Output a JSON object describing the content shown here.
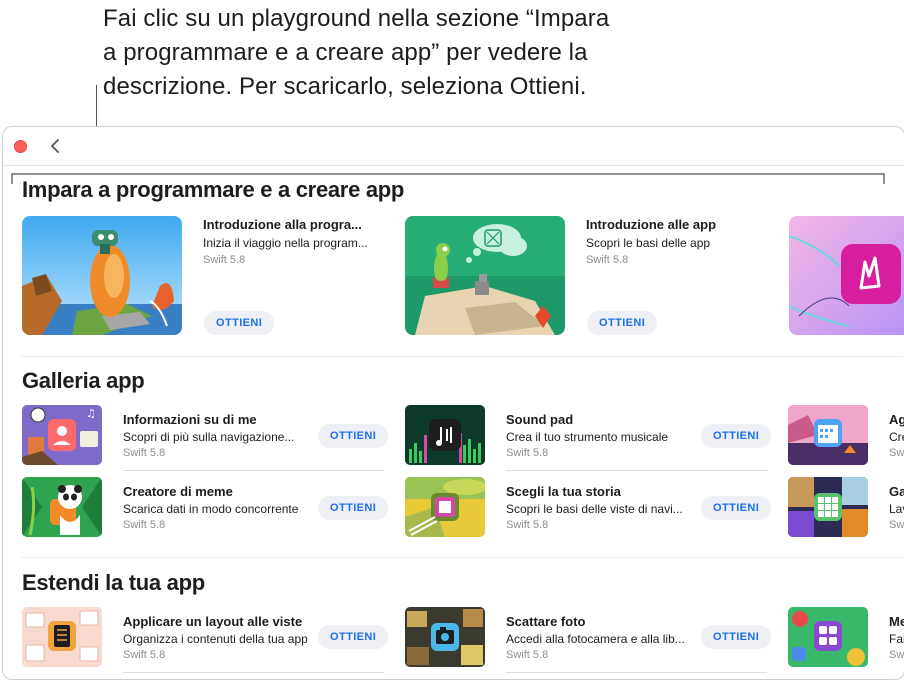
{
  "callout": {
    "line1": "Fai clic su un playground nella sezione “Impara",
    "line2": "a programmare e a creare app” per vedere la",
    "line3": "descrizione. Per scaricarlo, seleziona Ottieni."
  },
  "sections": [
    {
      "title": "Impara a programmare e a creare app",
      "items": [
        {
          "title": "Introduzione alla progra...",
          "desc": "Inizia il viaggio nella program...",
          "version": "Swift 5.8",
          "button": "OTTIENI"
        },
        {
          "title": "Introduzione alle app",
          "desc": "Scopri le basi delle app",
          "version": "Swift 5.8",
          "button": "OTTIENI"
        }
      ]
    },
    {
      "title": "Galleria app",
      "items": [
        {
          "title": "Informazioni su di me",
          "desc": "Scopri di più sulla navigazione...",
          "version": "Swift 5.8",
          "button": "OTTIENI"
        },
        {
          "title": "Sound pad",
          "desc": "Crea il tuo strumento musicale",
          "version": "Swift 5.8",
          "button": "OTTIENI"
        },
        {
          "title": "Ag",
          "desc": "Cre",
          "version": "Sw"
        },
        {
          "title": "Creatore di meme",
          "desc": "Scarica dati in modo concorrente",
          "version": "Swift 5.8",
          "button": "OTTIENI"
        },
        {
          "title": "Scegli la tua storia",
          "desc": "Scopri le basi delle viste di navi...",
          "version": "Swift 5.8",
          "button": "OTTIENI"
        },
        {
          "title": "Ga",
          "desc": "Lav",
          "version": "Sw"
        }
      ]
    },
    {
      "title": "Estendi la tua app",
      "items": [
        {
          "title": "Applicare un layout alle viste",
          "desc": "Organizza i contenuti della tua app",
          "version": "Swift 5.8",
          "button": "OTTIENI"
        },
        {
          "title": "Scattare foto",
          "desc": "Accedi alla fotocamera e alla lib...",
          "version": "Swift 5.8",
          "button": "OTTIENI"
        },
        {
          "title": "Me",
          "desc": "Fai",
          "version": "Sw"
        }
      ]
    }
  ],
  "colors": {
    "close": "#fe5f57",
    "accent": "#1c6fe6",
    "button_bg": "#eef0f5"
  }
}
